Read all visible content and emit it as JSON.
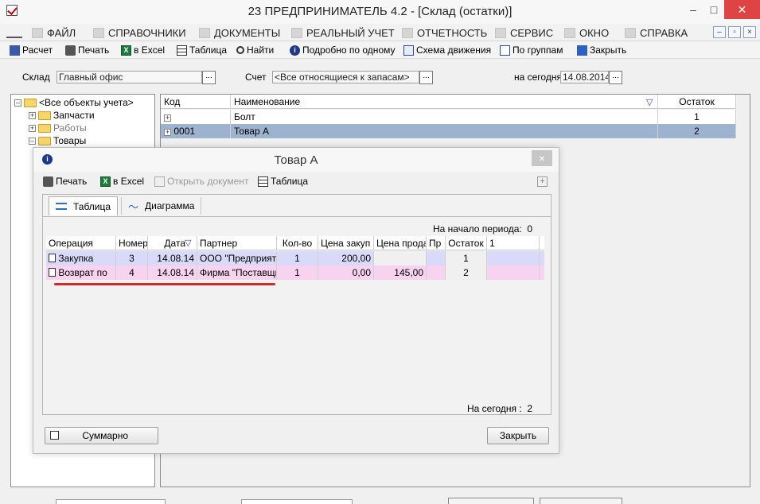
{
  "window": {
    "title": "23  ПРЕДПРИНИМАТЕЛЬ 4.2 - [Склад (остатки)]",
    "min": "–",
    "max": "□",
    "close": "✕"
  },
  "menu": {
    "items": [
      {
        "label": "ФАЙЛ"
      },
      {
        "label": "СПРАВОЧНИКИ"
      },
      {
        "label": "ДОКУМЕНТЫ"
      },
      {
        "label": "РЕАЛЬНЫЙ УЧЕТ"
      },
      {
        "label": "ОТЧЕТНОСТЬ"
      },
      {
        "label": "СЕРВИС"
      },
      {
        "label": "ОКНО"
      },
      {
        "label": "СПРАВКА"
      }
    ],
    "mdi": {
      "min": "–",
      "restore": "▫",
      "close": "×"
    }
  },
  "toolbar": {
    "items": [
      {
        "label": "Расчет"
      },
      {
        "label": "Печать"
      },
      {
        "label": "в Excel"
      },
      {
        "label": "Таблица"
      },
      {
        "label": "Найти"
      },
      {
        "label": "Подробно по одному"
      },
      {
        "label": "Схема движения"
      },
      {
        "label": "По группам"
      },
      {
        "label": "Закрыть"
      }
    ]
  },
  "filters": {
    "warehouse_label": "Склад",
    "warehouse_value": "Главный офис",
    "account_label": "Счет",
    "account_value": "<Все относящиеся к запасам>",
    "date_label": "на сегодня",
    "date_value": "14.08.2014",
    "dots": "..."
  },
  "tree": {
    "root": "<Все объекты учета>",
    "items": [
      {
        "label": "Запчасти",
        "color": "#000000"
      },
      {
        "label": "Работы",
        "color": "#7a7a7a"
      },
      {
        "label": "Товары",
        "color": "#000000"
      }
    ]
  },
  "grid": {
    "headers": {
      "code": "Код",
      "name": "Наименование",
      "rest": "Остаток"
    },
    "rows": [
      {
        "code": "",
        "name": "Болт",
        "rest": "1",
        "selected": false
      },
      {
        "code": "0001",
        "name": "Товар А",
        "rest": "2",
        "selected": true
      }
    ]
  },
  "modal": {
    "title": "Товар А",
    "close": "×",
    "toolbar": {
      "print": "Печать",
      "excel": "в Excel",
      "open_doc": "Открыть документ",
      "table": "Таблица"
    },
    "tabs": [
      {
        "label": "Таблица"
      },
      {
        "label": "Диаграмма"
      }
    ],
    "start_period": {
      "label": "На начало периода:",
      "value": "0"
    },
    "table": {
      "headers": [
        "Операция",
        "Номер",
        "Дата",
        "Партнер",
        "Кол-во",
        "Цена закуп",
        "Цена прода",
        "Пр",
        "Остаток",
        "1"
      ],
      "rows": [
        {
          "op": "Закупка",
          "num": "3",
          "date": "14.08.14",
          "partner": "ООО \"Предприят",
          "qty": "1",
          "buy": "200,00",
          "sell": "",
          "pr": "",
          "rest": "1",
          "one": ""
        },
        {
          "op": "Возврат по",
          "num": "4",
          "date": "14.08.14",
          "partner": "Фирма \"Поставщи",
          "qty": "1",
          "buy": "0,00",
          "sell": "145,00",
          "pr": "",
          "rest": "2",
          "one": ""
        }
      ]
    },
    "today": {
      "label": "На сегодня :",
      "value": "2"
    },
    "summary_label": "Суммарно",
    "close_label": "Закрыть",
    "row_colors": {
      "purchase": "#d9d9fa",
      "return": "#f8d3f0",
      "underline": "#d32a2a"
    }
  },
  "bottom": {
    "left_label": "…",
    "right_label": "…"
  }
}
